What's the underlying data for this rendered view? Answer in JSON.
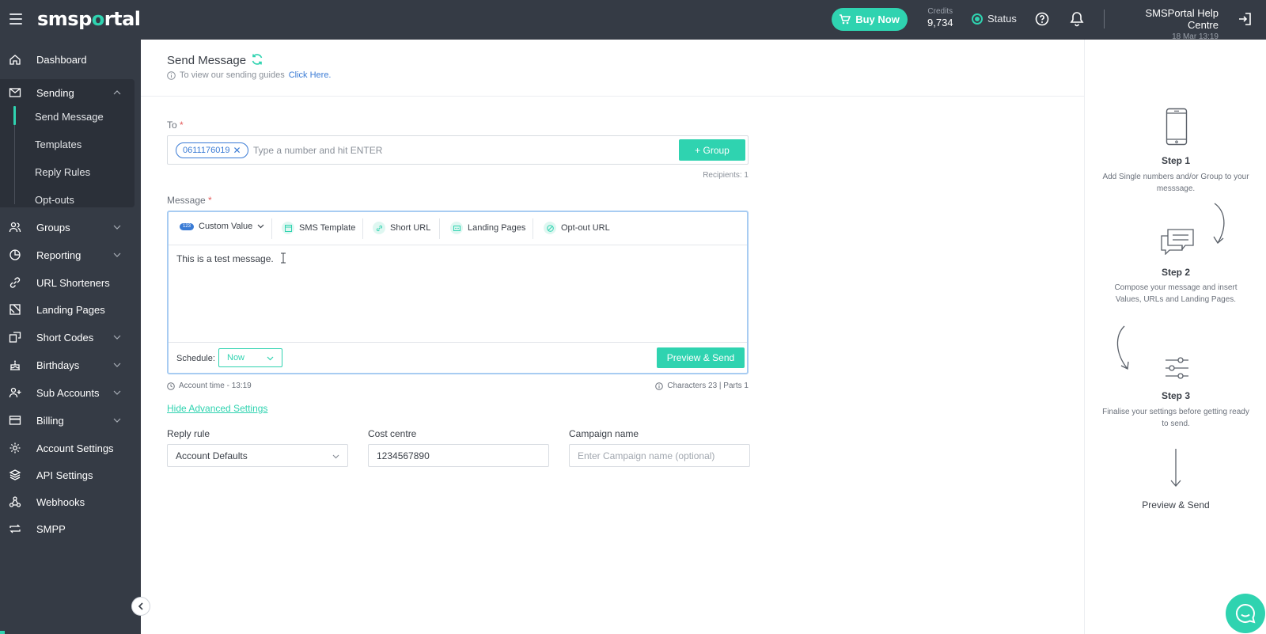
{
  "topbar": {
    "logo_pre": "sms",
    "logo_o": "o",
    "logo_post": "rtal",
    "logo_p": "p",
    "buy_now": "Buy Now",
    "credits_label": "Credits",
    "credits_value": "9,734",
    "status": "Status",
    "help_centre": "SMSPortal Help Centre",
    "datetime": "18 Mar 13:19"
  },
  "sidebar": {
    "dashboard": "Dashboard",
    "sending": "Sending",
    "sub": [
      "Send Message",
      "Templates",
      "Reply Rules",
      "Opt-outs"
    ],
    "groups": "Groups",
    "reporting": "Reporting",
    "url_shorteners": "URL Shorteners",
    "landing_pages": "Landing Pages",
    "short_codes": "Short Codes",
    "birthdays": "Birthdays",
    "sub_accounts": "Sub Accounts",
    "billing": "Billing",
    "account_settings": "Account Settings",
    "api_settings": "API Settings",
    "webhooks": "Webhooks",
    "smpp": "SMPP"
  },
  "main": {
    "title": "Send Message",
    "guide_text": "To view our sending guides",
    "guide_link": "Click Here.",
    "to_label": "To",
    "required_mark": "*",
    "recipient_chip": "0611176019",
    "to_placeholder": "Type a number and hit ENTER",
    "group_button": "+ Group",
    "recipients": "Recipients: 1",
    "message_label": "Message",
    "toolbar": {
      "custom_value_badge": "123",
      "custom_value": "Custom Value",
      "sms_template": "SMS Template",
      "short_url": "Short URL",
      "landing_pages": "Landing Pages",
      "optout_url": "Opt-out URL"
    },
    "message_text": "This is a test message.",
    "schedule_label": "Schedule:",
    "schedule_value": "Now",
    "preview_send": "Preview & Send",
    "account_time": "Account time - 13:19",
    "characters": "Characters 23 | Parts 1",
    "hide_advanced": "Hide Advanced Settings",
    "reply_rule_label": "Reply rule",
    "reply_rule_value": "Account Defaults",
    "cost_centre_label": "Cost centre",
    "cost_centre_value": "1234567890",
    "campaign_label": "Campaign name",
    "campaign_placeholder": "Enter Campaign name (optional)"
  },
  "steps": {
    "step1_title": "Step 1",
    "step1_desc": "Add Single numbers and/or Group to your messsage.",
    "step2_title": "Step 2",
    "step2_desc": "Compose your message and insert Values, URLs and Landing Pages.",
    "step3_title": "Step 3",
    "step3_desc": "Finalise your settings before getting ready to send.",
    "final": "Preview & Send"
  },
  "colors": {
    "accent": "#2fd3b0",
    "topbar_bg": "#353b45",
    "link": "#3a7bd5"
  }
}
